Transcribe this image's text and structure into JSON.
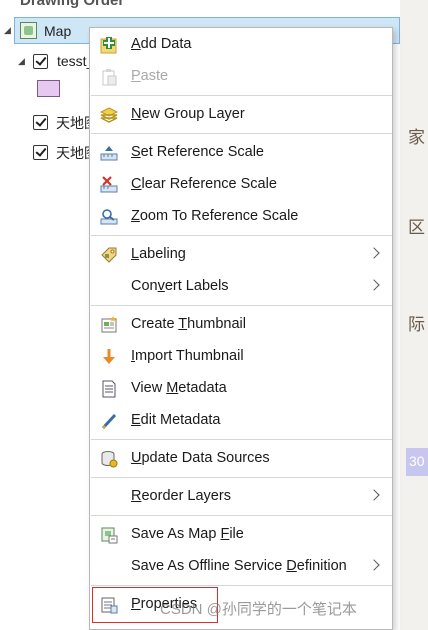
{
  "pane": {
    "title": "Drawing Order",
    "map_label": "Map",
    "layers": [
      {
        "label": "tesst_",
        "checked": true
      },
      {
        "label": "天地图",
        "checked": true
      },
      {
        "label": "天地图",
        "checked": true
      }
    ],
    "swatch_color": "#e6c8f0"
  },
  "map_strip": {
    "glyphs": [
      "家",
      "区",
      "际"
    ],
    "badge": "30"
  },
  "menu": {
    "items": [
      {
        "id": "add-data",
        "prefix": "",
        "key": "A",
        "rest": "dd Data",
        "icon": "add-data-icon",
        "enabled": true,
        "submenu": false
      },
      {
        "id": "paste",
        "prefix": "",
        "key": "P",
        "rest": "aste",
        "icon": "paste-icon",
        "enabled": false,
        "submenu": false
      },
      {
        "id": "new-group-layer",
        "prefix": "",
        "key": "N",
        "rest": "ew Group Layer",
        "icon": "group-layer-icon",
        "enabled": true,
        "submenu": false
      },
      {
        "id": "set-reference-scale",
        "prefix": "",
        "key": "S",
        "rest": "et Reference Scale",
        "icon": "set-scale-icon",
        "enabled": true,
        "submenu": false
      },
      {
        "id": "clear-reference-scale",
        "prefix": "",
        "key": "C",
        "rest": "lear Reference Scale",
        "icon": "clear-scale-icon",
        "enabled": true,
        "submenu": false
      },
      {
        "id": "zoom-to-reference-scale",
        "prefix": "",
        "key": "Z",
        "rest": "oom To Reference Scale",
        "icon": "zoom-scale-icon",
        "enabled": true,
        "submenu": false
      },
      {
        "id": "labeling",
        "prefix": "",
        "key": "L",
        "rest": "abeling",
        "icon": "labeling-icon",
        "enabled": true,
        "submenu": true
      },
      {
        "id": "convert-labels",
        "prefix": "Con",
        "key": "v",
        "rest": "ert Labels",
        "icon": "",
        "enabled": true,
        "submenu": true
      },
      {
        "id": "create-thumbnail",
        "prefix": "Create ",
        "key": "T",
        "rest": "humbnail",
        "icon": "create-thumbnail-icon",
        "enabled": true,
        "submenu": false
      },
      {
        "id": "import-thumbnail",
        "prefix": "",
        "key": "I",
        "rest": "mport Thumbnail",
        "icon": "import-thumbnail-icon",
        "enabled": true,
        "submenu": false
      },
      {
        "id": "view-metadata",
        "prefix": "View ",
        "key": "M",
        "rest": "etadata",
        "icon": "view-metadata-icon",
        "enabled": true,
        "submenu": false
      },
      {
        "id": "edit-metadata",
        "prefix": "",
        "key": "E",
        "rest": "dit Metadata",
        "icon": "edit-metadata-icon",
        "enabled": true,
        "submenu": false
      },
      {
        "id": "update-data-sources",
        "prefix": "",
        "key": "U",
        "rest": "pdate Data Sources",
        "icon": "update-data-sources-icon",
        "enabled": true,
        "submenu": false
      },
      {
        "id": "reorder-layers",
        "prefix": "",
        "key": "R",
        "rest": "eorder Layers",
        "icon": "",
        "enabled": true,
        "submenu": true
      },
      {
        "id": "save-as-map-file",
        "prefix": "Save As Map ",
        "key": "F",
        "rest": "ile",
        "icon": "save-map-file-icon",
        "enabled": true,
        "submenu": false
      },
      {
        "id": "save-as-offline-service-definition",
        "prefix": "Save As Offline Service ",
        "key": "D",
        "rest": "efinition",
        "icon": "",
        "enabled": true,
        "submenu": true
      },
      {
        "id": "properties",
        "prefix": "",
        "key": "P",
        "rest": "roperties",
        "icon": "properties-icon",
        "enabled": true,
        "submenu": false
      }
    ]
  },
  "watermark": "CSDN @孙同学的一个笔记本",
  "colors": {
    "selection_bg": "#cfe6f7",
    "highlight_box": "#e02b2b",
    "disabled_text": "#a8a8a8"
  }
}
